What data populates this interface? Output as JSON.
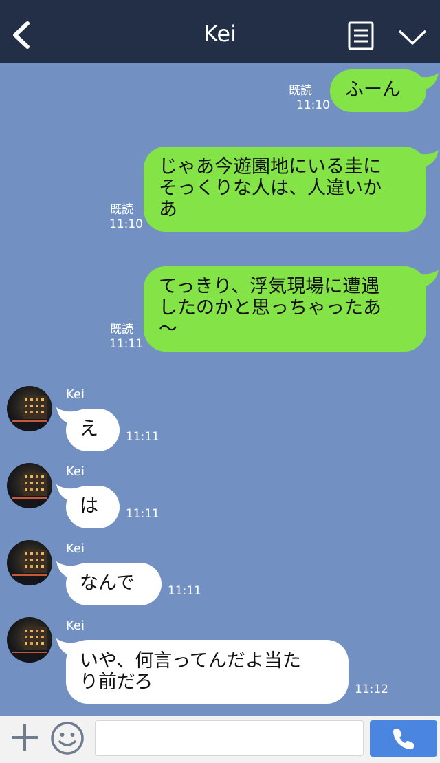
{
  "header": {
    "title": "Kei"
  },
  "contact": {
    "name": "Kei"
  },
  "messages": [
    {
      "side": "out",
      "text": "ふーん",
      "read": "既読",
      "time": "11:10"
    },
    {
      "side": "out",
      "text": "じゃあ今遊園地にいる圭に\nそっくりな人は、人違いか\nあ",
      "read": "既読",
      "time": "11:10"
    },
    {
      "side": "out",
      "text": "てっきり、浮気現場に遭遇\nしたのかと思っちゃったあ\n〜",
      "read": "既読",
      "time": "11:11"
    },
    {
      "side": "in",
      "sender": "Kei",
      "text": "え",
      "time": "11:11"
    },
    {
      "side": "in",
      "sender": "Kei",
      "text": "は",
      "time": "11:11"
    },
    {
      "side": "in",
      "sender": "Kei",
      "text": "なんで",
      "time": "11:11"
    },
    {
      "side": "in",
      "sender": "Kei",
      "text": "いや、何言ってんだよ当た\nり前だろ",
      "time": "11:12"
    }
  ],
  "composer": {
    "placeholder": ""
  },
  "colors": {
    "background": "#7291c2",
    "header": "#232f47",
    "outgoing_bubble": "#84e346",
    "incoming_bubble": "#ffffff",
    "call_button": "#4a86df"
  },
  "icons": [
    "back-arrow-icon",
    "notes-icon",
    "chevron-down-icon",
    "plus-icon",
    "smile-icon",
    "phone-icon"
  ]
}
